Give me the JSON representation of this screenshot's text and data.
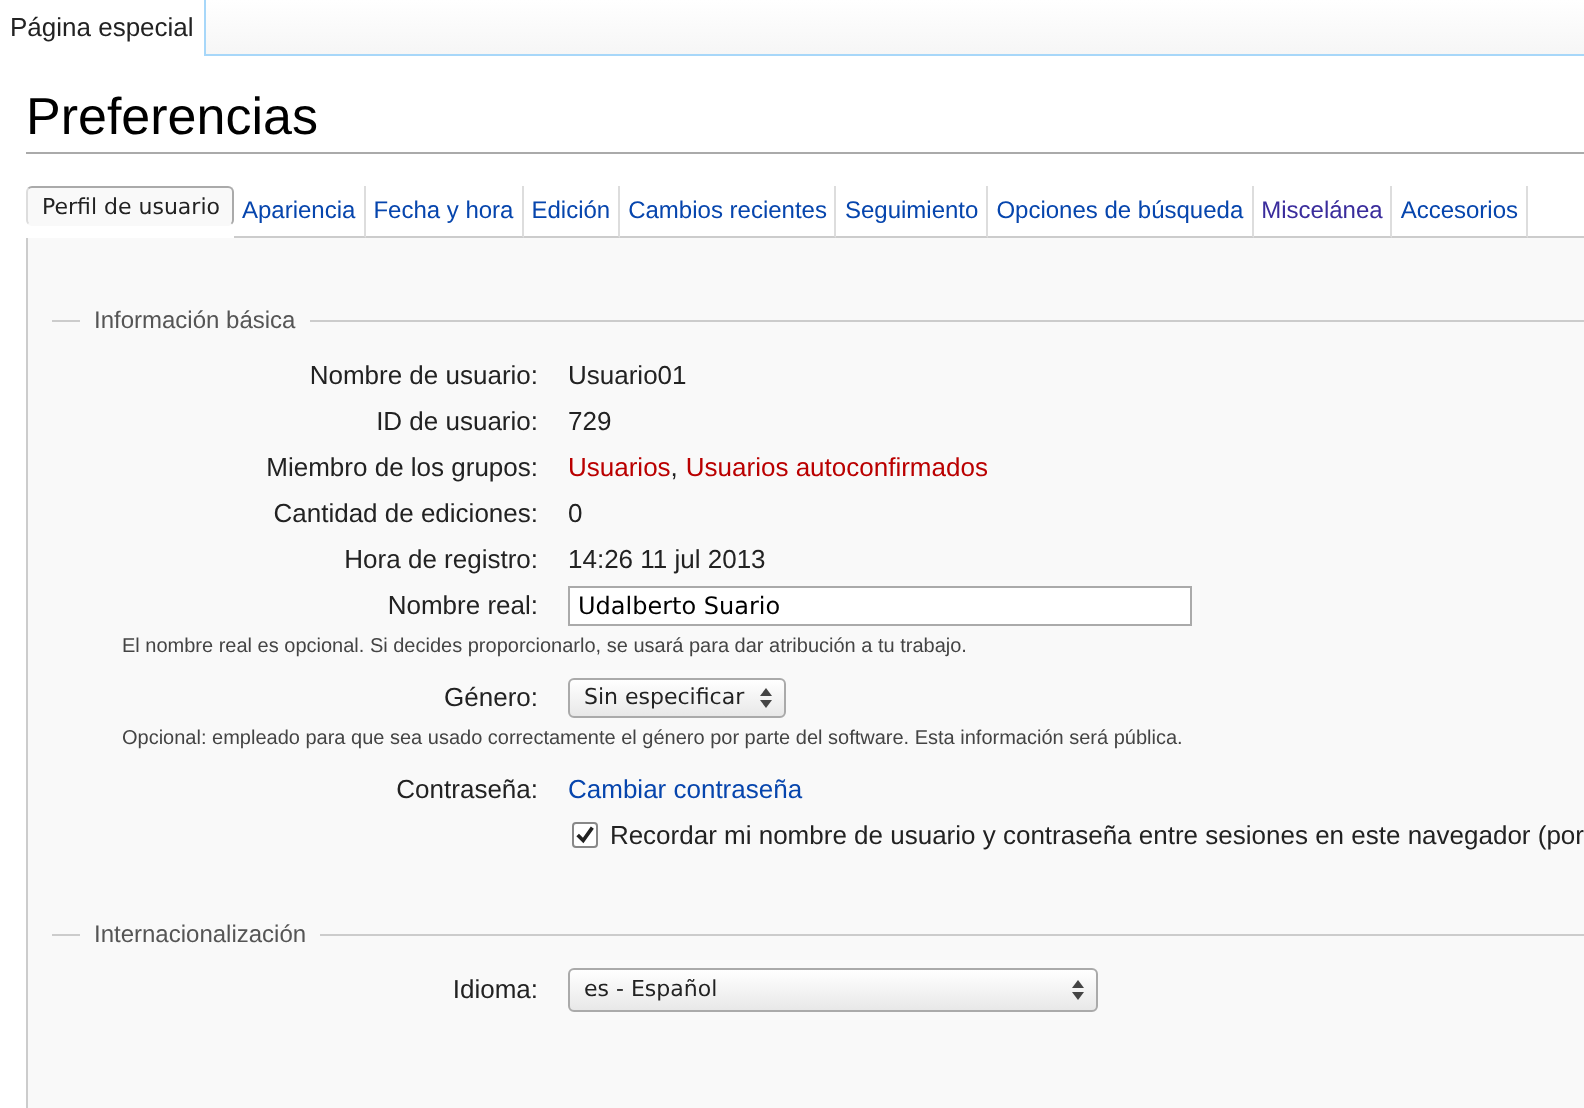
{
  "page_tab": {
    "label": "Página especial",
    "selected": true
  },
  "title": "Preferencias",
  "tabs": [
    {
      "label": "Perfil de usuario",
      "selected": true,
      "visited": false
    },
    {
      "label": "Apariencia",
      "selected": false,
      "visited": false
    },
    {
      "label": "Fecha y hora",
      "selected": false,
      "visited": false
    },
    {
      "label": "Edición",
      "selected": false,
      "visited": false
    },
    {
      "label": "Cambios recientes",
      "selected": false,
      "visited": false
    },
    {
      "label": "Seguimiento",
      "selected": false,
      "visited": false
    },
    {
      "label": "Opciones de búsqueda",
      "selected": false,
      "visited": false
    },
    {
      "label": "Miscelánea",
      "selected": false,
      "visited": true
    },
    {
      "label": "Accesorios",
      "selected": false,
      "visited": false
    }
  ],
  "sections": [
    {
      "legend": "Información básica",
      "rows": [
        {
          "kind": "text",
          "label": "Nombre de usuario:",
          "value": "Usuario01"
        },
        {
          "kind": "text",
          "label": "ID de usuario:",
          "value": "729"
        },
        {
          "kind": "groups",
          "label": "Miembro de los grupos:",
          "links": [
            "Usuarios",
            "Usuarios autoconfirmados"
          ],
          "separator": ","
        },
        {
          "kind": "text",
          "label": "Cantidad de ediciones:",
          "value": "0"
        },
        {
          "kind": "text",
          "label": "Hora de registro:",
          "value": "14:26 11 jul 2013"
        },
        {
          "kind": "input",
          "label": "Nombre real:",
          "value": "Udalberto Suario"
        },
        {
          "kind": "help",
          "text": "El nombre real es opcional. Si decides proporcionarlo, se usará para dar atribución a tu trabajo."
        },
        {
          "kind": "select",
          "label": "Género:",
          "value": "Sin especificar"
        },
        {
          "kind": "help",
          "text": "Opcional: empleado para que sea usado correctamente el género por parte del software. Esta información será pública."
        },
        {
          "kind": "link",
          "label": "Contraseña:",
          "value": "Cambiar contraseña"
        },
        {
          "kind": "checkbox",
          "label": "Recordar mi nombre de usuario y contraseña entre sesiones en este navegador (por",
          "checked": true
        }
      ]
    },
    {
      "legend": "Internacionalización",
      "rows": [
        {
          "kind": "wideselect",
          "label": "Idioma:",
          "value": "es - Español"
        }
      ]
    }
  ]
}
